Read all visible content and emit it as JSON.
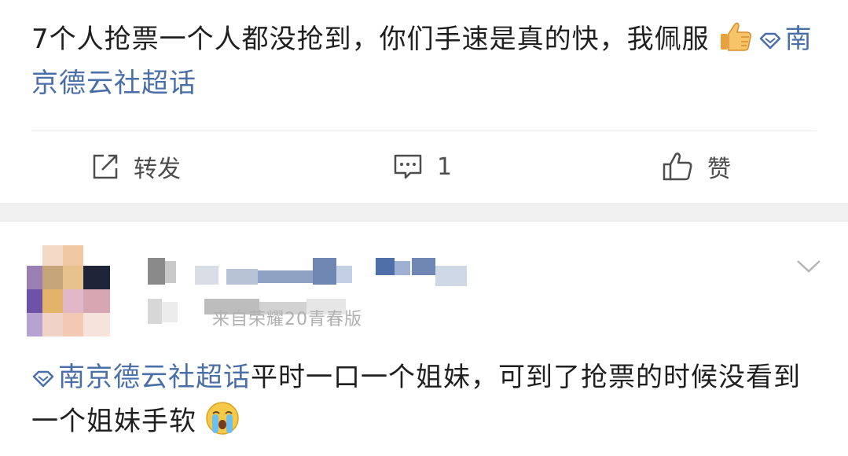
{
  "post1": {
    "text_line": "7个人抢票一个人都没抢到，你们手速是真的快，我佩服",
    "emoji": "thumbs-up-emoji",
    "topic": "南京德云社超话"
  },
  "actions": {
    "repost_label": "转发",
    "comment_count": "1",
    "like_label": "赞"
  },
  "post2": {
    "meta_visible": "来自荣耀20青春版",
    "topic": "南京德云社超话",
    "text": "平时一口一个姐妹，可到了抢票的时候没看到一个姐妹手软",
    "emoji": "crying-emoji"
  },
  "colors": {
    "link": "#4a6ea8",
    "text": "#1f1f1f",
    "muted": "#4d4d4d",
    "gap": "#f0f0f0"
  }
}
